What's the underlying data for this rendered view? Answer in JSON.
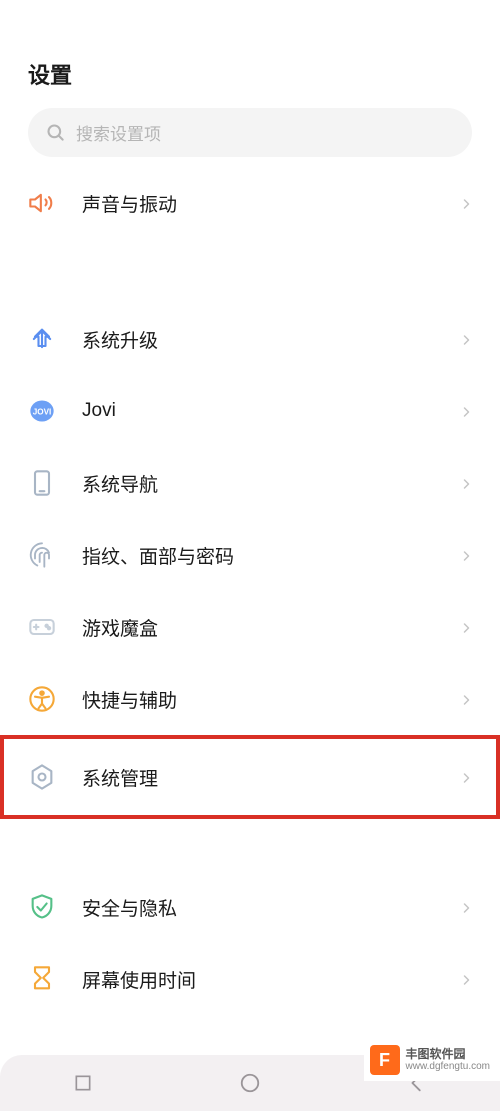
{
  "header": {
    "title": "设置"
  },
  "search": {
    "placeholder": "搜索设置项"
  },
  "items": {
    "sound": {
      "label": "声音与振动"
    },
    "system_upgrade": {
      "label": "系统升级"
    },
    "jovi": {
      "label": "Jovi"
    },
    "system_nav": {
      "label": "系统导航"
    },
    "biometrics": {
      "label": "指纹、面部与密码"
    },
    "gamebox": {
      "label": "游戏魔盒"
    },
    "shortcut": {
      "label": "快捷与辅助"
    },
    "system_mgmt": {
      "label": "系统管理"
    },
    "security": {
      "label": "安全与隐私"
    },
    "screentime": {
      "label": "屏幕使用时间"
    }
  },
  "icon_colors": {
    "sound": "#f07d4a",
    "upgrade": "#5a8ef0",
    "jovi": "#5a8ef0",
    "nav": "#a8b5c5",
    "fingerprint": "#a8b5c5",
    "gamebox": "#c7d0da",
    "shortcut": "#f5a838",
    "system_mgmt": "#a8b5c5",
    "security": "#55c088",
    "screentime": "#f5a838"
  },
  "watermark": {
    "title": "丰图软件园",
    "url": "www.dgfengtu.com",
    "logo_char": "F"
  }
}
